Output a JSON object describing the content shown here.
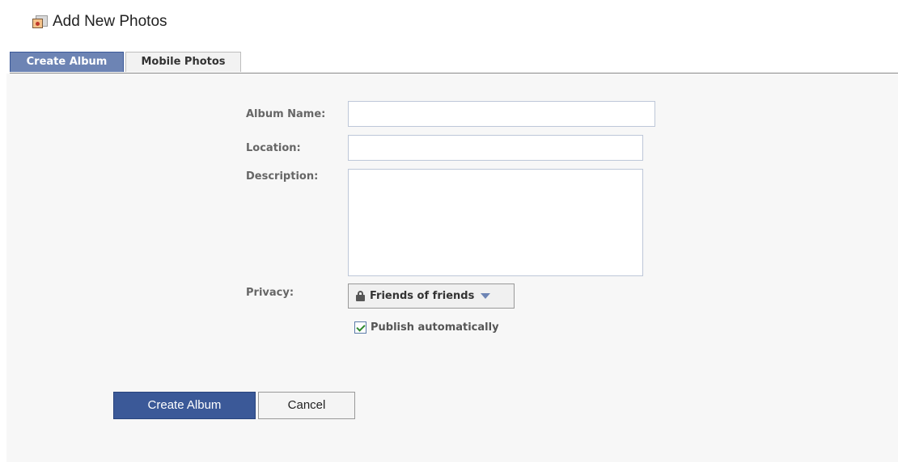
{
  "header": {
    "title": "Add New Photos",
    "icon": "photo-album-icon"
  },
  "tabs": [
    {
      "label": "Create Album",
      "active": true
    },
    {
      "label": "Mobile Photos",
      "active": false
    }
  ],
  "form": {
    "album_name": {
      "label": "Album Name:",
      "value": ""
    },
    "location": {
      "label": "Location:",
      "value": ""
    },
    "description": {
      "label": "Description:",
      "value": ""
    },
    "privacy": {
      "label": "Privacy:",
      "selected": "Friends of friends",
      "icon": "lock-icon"
    },
    "publish": {
      "label": "Publish automatically",
      "checked": true
    }
  },
  "buttons": {
    "create": "Create Album",
    "cancel": "Cancel"
  },
  "colors": {
    "brand": "#3b5998",
    "tab_active": "#6d84b4",
    "panel_bg": "#f7f7f7"
  }
}
